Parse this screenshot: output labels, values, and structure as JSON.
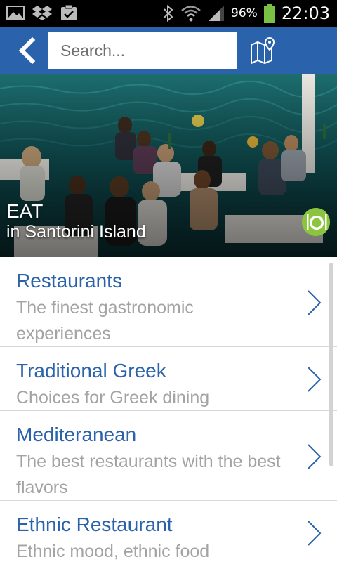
{
  "status_bar": {
    "battery_percent": "96%",
    "time": "22:03",
    "icons": [
      "gallery-icon",
      "dropbox-icon",
      "clipboard-check-icon",
      "bluetooth-icon",
      "wifi-icon",
      "signal-icon",
      "battery-icon"
    ]
  },
  "app_bar": {
    "search_placeholder": "Search...",
    "back_icon": "chevron-left-icon",
    "map_icon": "map-pin-icon",
    "background_color": "#2a63ab"
  },
  "hero": {
    "title": "EAT",
    "subtitle": "in Santorini Island",
    "badge_icon": "plate-cutlery-icon",
    "badge_color": "#8bc53f"
  },
  "list": {
    "items": [
      {
        "title": "Restaurants",
        "description": "The finest gastronomic experiences"
      },
      {
        "title": "Traditional Greek",
        "description": "Choices for Greek dining"
      },
      {
        "title": "Mediteranean",
        "description": "The best restaurants with the best flavors"
      },
      {
        "title": "Ethnic Restaurant",
        "description": "Ethnic mood, ethnic food"
      }
    ],
    "title_color": "#2a63ab",
    "description_color": "#a3a3a3"
  }
}
